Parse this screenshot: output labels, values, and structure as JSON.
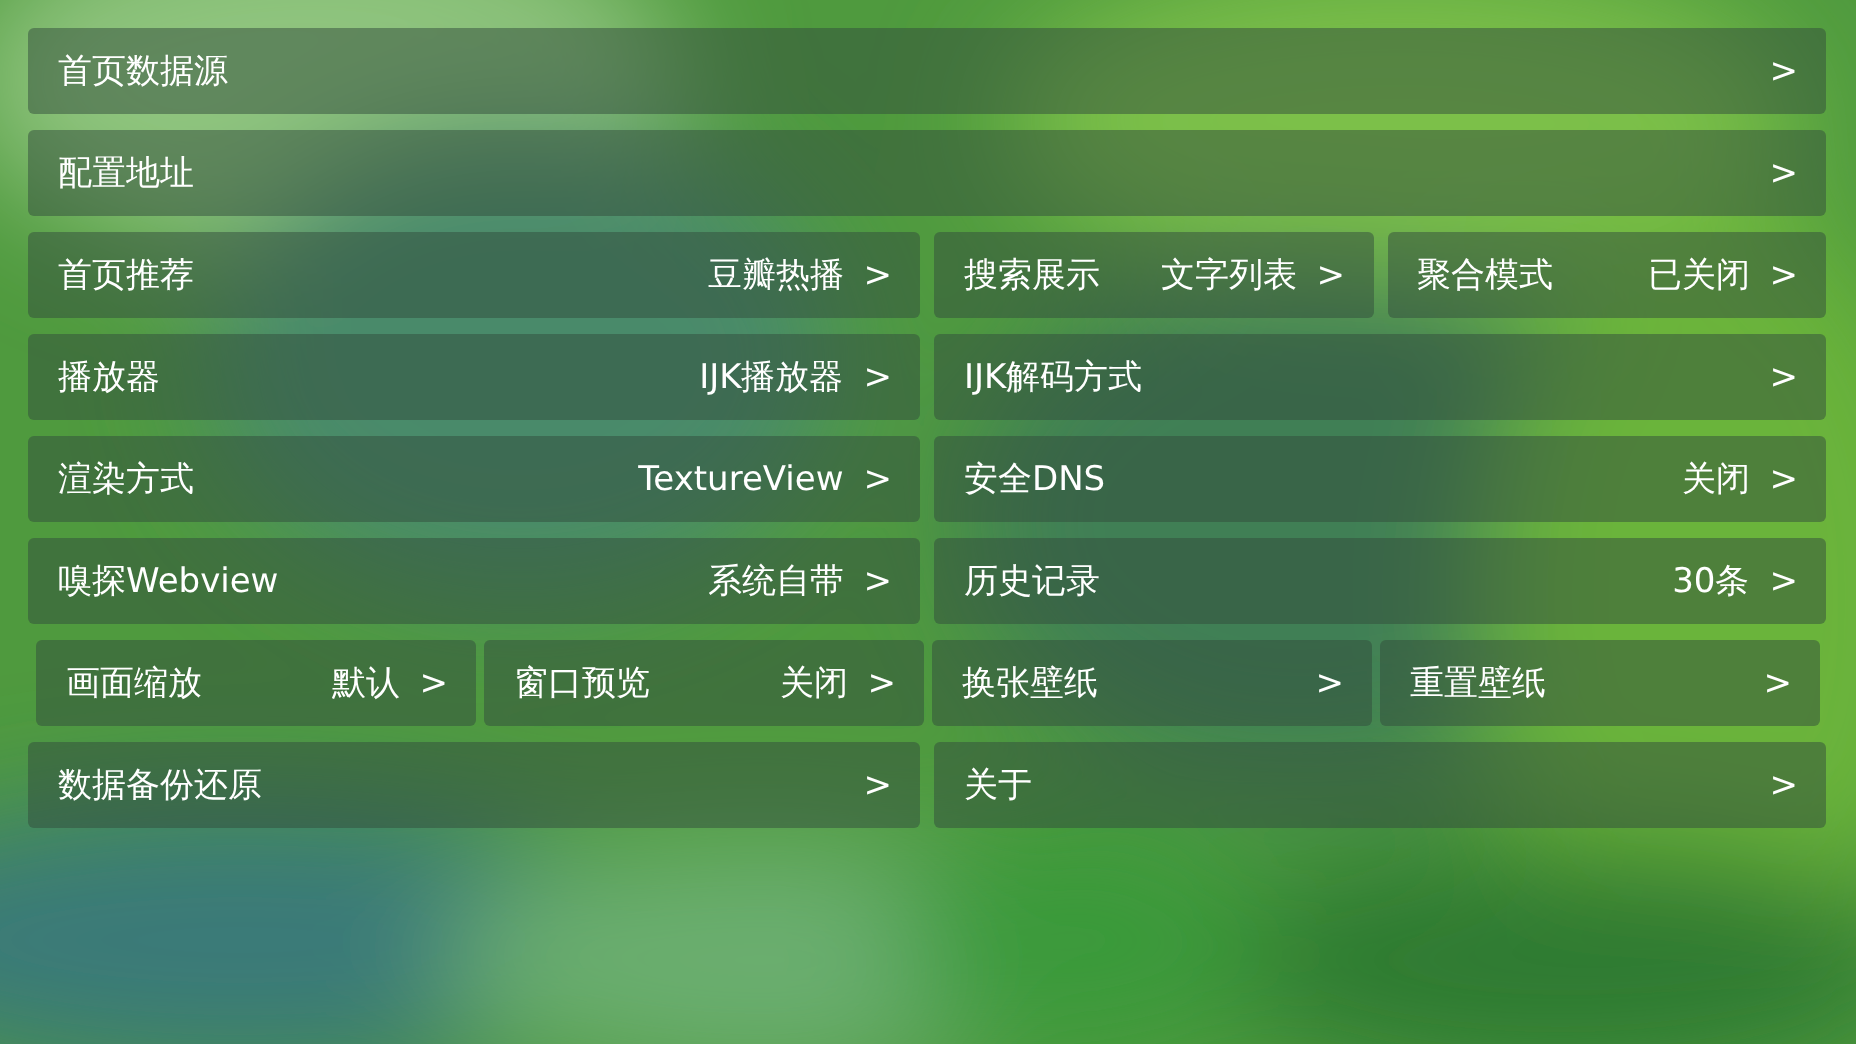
{
  "rows": [
    {
      "kind": "normal",
      "items": [
        {
          "kind": "full",
          "label": "首页数据源",
          "arrow": ">"
        }
      ]
    },
    {
      "kind": "normal",
      "items": [
        {
          "kind": "full",
          "label": "配置地址",
          "arrow": ">"
        }
      ]
    },
    {
      "kind": "normal",
      "items": [
        {
          "kind": "half",
          "label": "首页推荐",
          "value": "豆瓣热播",
          "arrow": ">"
        },
        {
          "kind": "quarter",
          "label": "搜索展示",
          "value": "文字列表",
          "arrow": ">"
        },
        {
          "kind": "quarter",
          "label": "聚合模式",
          "value": "已关闭",
          "arrow": ">"
        }
      ]
    },
    {
      "kind": "normal",
      "items": [
        {
          "kind": "half",
          "label": "播放器",
          "value": "IJK播放器",
          "arrow": ">"
        },
        {
          "kind": "half",
          "label": "IJK解码方式",
          "arrow": ">"
        }
      ]
    },
    {
      "kind": "normal",
      "items": [
        {
          "kind": "half",
          "label": "渲染方式",
          "value": "TextureView",
          "arrow": ">"
        },
        {
          "kind": "half",
          "label": "安全DNS",
          "value": "关闭",
          "arrow": ">"
        }
      ]
    },
    {
      "kind": "normal",
      "items": [
        {
          "kind": "half",
          "label": "嗅探Webview",
          "value": "系统自带",
          "arrow": ">"
        },
        {
          "kind": "half",
          "label": "历史记录",
          "value": "30条",
          "arrow": ">"
        }
      ]
    },
    {
      "kind": "inset",
      "items": [
        {
          "kind": "quarter",
          "label": "画面缩放",
          "value": "默认",
          "arrow": ">"
        },
        {
          "kind": "quarter",
          "label": "窗口预览",
          "value": "关闭",
          "arrow": ">"
        },
        {
          "kind": "quarter",
          "label": "换张壁纸",
          "arrow": ">"
        },
        {
          "kind": "quarter",
          "label": "重置壁纸",
          "arrow": ">"
        }
      ]
    },
    {
      "kind": "normal",
      "items": [
        {
          "kind": "half",
          "label": "数据备份还原",
          "arrow": ">"
        },
        {
          "kind": "half",
          "label": "关于",
          "arrow": ">"
        }
      ]
    }
  ]
}
